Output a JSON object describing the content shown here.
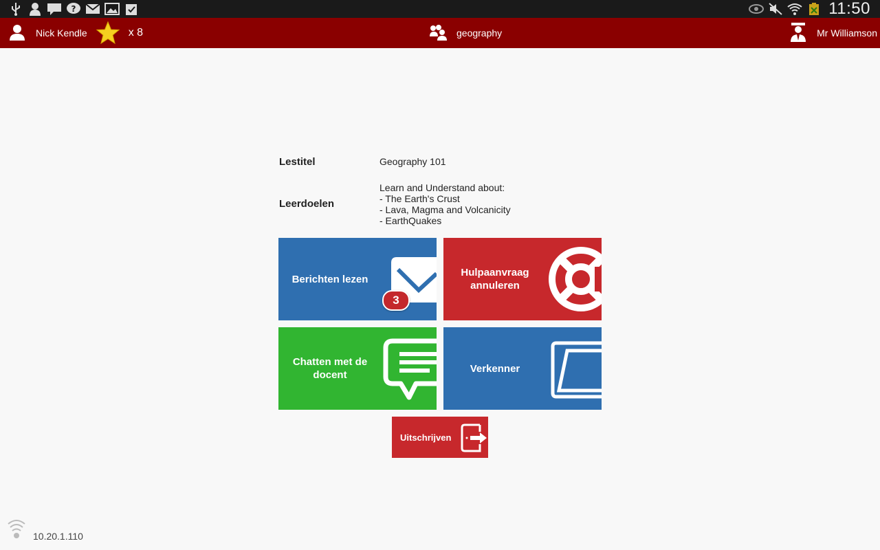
{
  "status_bar": {
    "left_icons": [
      "usb-icon",
      "person-icon",
      "message-icon",
      "help-icon",
      "mail-muted-icon",
      "gallery-icon",
      "clipboard-check-icon"
    ],
    "right_icons": [
      "eye-icon",
      "mute-icon",
      "wifi-icon",
      "battery-charging-icon"
    ],
    "time": "11:50"
  },
  "header": {
    "student_name": "Nick Kendle",
    "stars_count": "x 8",
    "class_name": "geography",
    "teacher_name": "Mr Williamson",
    "colors": {
      "background": "#8a0000",
      "star": "#f5d020"
    }
  },
  "lesson": {
    "title_label": "Lestitel",
    "title_value": "Geography 101",
    "goals_label": "Leerdoelen",
    "goals_lines": [
      "Learn and Understand about:",
      "- The Earth's Crust",
      "- Lava, Magma and Volcanicity",
      "- EarthQuakes"
    ]
  },
  "tiles": {
    "messages": {
      "label": "Berichten lezen",
      "badge": "3",
      "icon": "envelope-icon",
      "color": "#2f6fb0"
    },
    "help": {
      "label": "Hulpaanvraag annuleren",
      "icon": "lifebuoy-icon",
      "color": "#c7282c"
    },
    "chat": {
      "label": "Chatten met de docent",
      "icon": "chat-bubble-icon",
      "color": "#31b531"
    },
    "explorer": {
      "label": "Verkenner",
      "icon": "folder-icon",
      "color": "#2f6fb0"
    }
  },
  "logout": {
    "label": "Uitschrijven",
    "icon": "exit-door-icon",
    "color": "#c7282c"
  },
  "footer": {
    "ip": "10.20.1.110",
    "icon": "wifi-signal-icon"
  }
}
